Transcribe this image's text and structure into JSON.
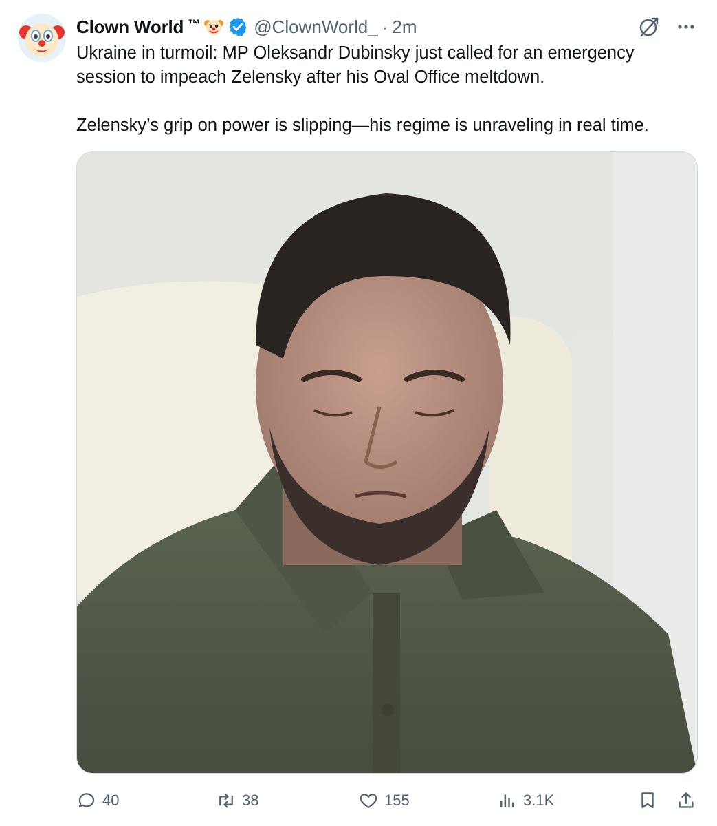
{
  "author": {
    "display_name": "Clown World",
    "tm": "™",
    "handle": "@ClownWorld_",
    "separator": "·",
    "time": "2m",
    "avatar_icon": "clown-face-icon",
    "badge_emoji": "clown-face-icon",
    "verified_color": "#1d9bf0"
  },
  "post": {
    "line1": "Ukraine in turmoil: MP Oleksandr Dubinsky just called for an emergency session to impeach Zelensky after his Oval Office meltdown.",
    "line2": "Zelensky’s grip on power is slipping—his regime is unraveling in real time."
  },
  "media": {
    "kind": "photo"
  },
  "actions": {
    "replies": "40",
    "reposts": "38",
    "likes": "155",
    "views": "3.1K"
  },
  "colors": {
    "text": "#0f1419",
    "muted": "#536471",
    "border": "#cfd9de"
  }
}
